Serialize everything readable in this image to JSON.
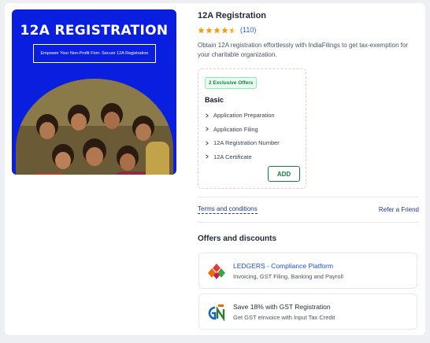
{
  "hero": {
    "title": "12A REGISTRATION",
    "subtitle": "Empower Your Non-Profit Firm: Secure 12A Registration"
  },
  "product": {
    "title": "12A Registration",
    "rating_stars": 4.5,
    "rating_count": "(110)",
    "description": "Obtain 12A registration effortlessly with IndiaFilings to get tax-exemption for your charitable organization."
  },
  "offer_card": {
    "badge": "2 Exclusive Offers",
    "plan": "Basic",
    "items": [
      "Application Preparation",
      "Application Filing",
      "12A Registration Number",
      "12A Certificate"
    ],
    "add_label": "ADD"
  },
  "links": {
    "terms": "Terms and conditions",
    "refer": "Refer a Friend"
  },
  "offers": {
    "heading": "Offers and discounts",
    "items": [
      {
        "title": "LEDGERS - Compliance Platform",
        "subtitle": "Invoicing, GST Filing, Banking and Payroll",
        "icon": "ledgers-logo-icon",
        "title_color": "#1d4ed8"
      },
      {
        "title": "Save 18% with GST Registration",
        "subtitle": "Get GST eInvoice with Input Tax Credit",
        "icon": "gst-logo-icon",
        "title_color": "#1f2937"
      }
    ]
  },
  "colors": {
    "hero_bg": "#0a1ee0",
    "star": "#f59e0b",
    "add_green": "#15803d",
    "link_blue": "#1e3a8a"
  }
}
